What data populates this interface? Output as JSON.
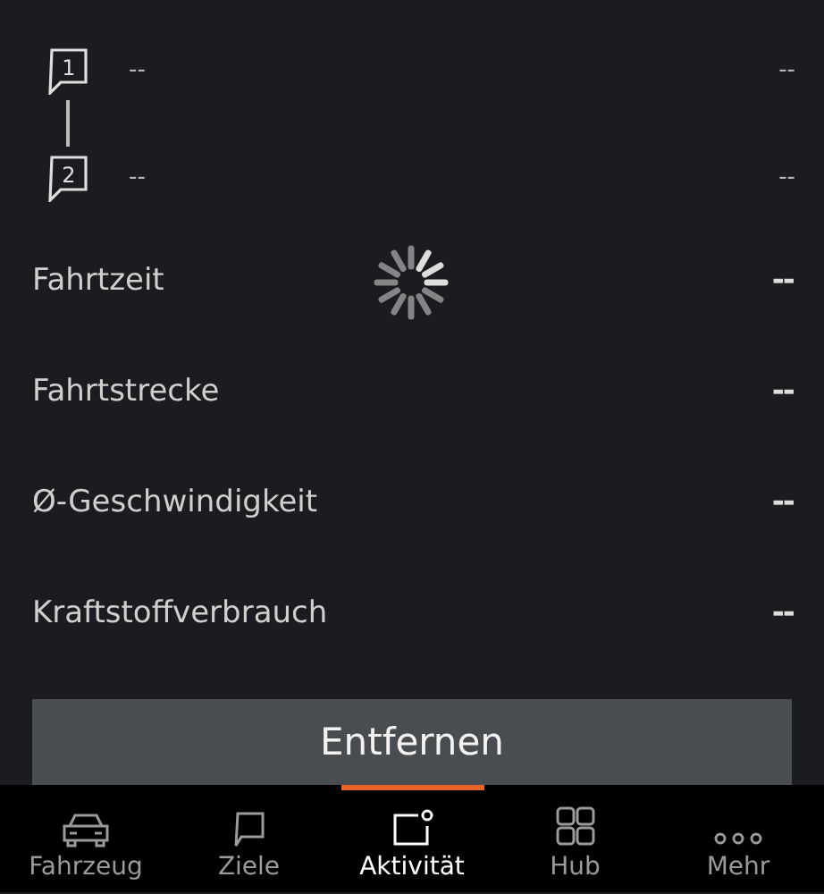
{
  "waypoints": [
    {
      "number": "1",
      "name": "--",
      "value": "--"
    },
    {
      "number": "2",
      "name": "--",
      "value": "--"
    }
  ],
  "loading": true,
  "stats": [
    {
      "label": "Fahrtzeit",
      "value": "--"
    },
    {
      "label": "Fahrtstrecke",
      "value": "--"
    },
    {
      "label": "Ø-Geschwindigkeit",
      "value": "--"
    },
    {
      "label": "Kraftstoffverbrauch",
      "value": "--"
    }
  ],
  "remove_button": "Entfernen",
  "nav": [
    {
      "label": "Fahrzeug",
      "kind": "car",
      "selected": false
    },
    {
      "label": "Ziele",
      "kind": "flag",
      "selected": false
    },
    {
      "label": "Aktivität",
      "kind": "activity",
      "selected": true
    },
    {
      "label": "Hub",
      "kind": "grid",
      "selected": false
    },
    {
      "label": "Mehr",
      "kind": "more",
      "selected": false
    }
  ]
}
